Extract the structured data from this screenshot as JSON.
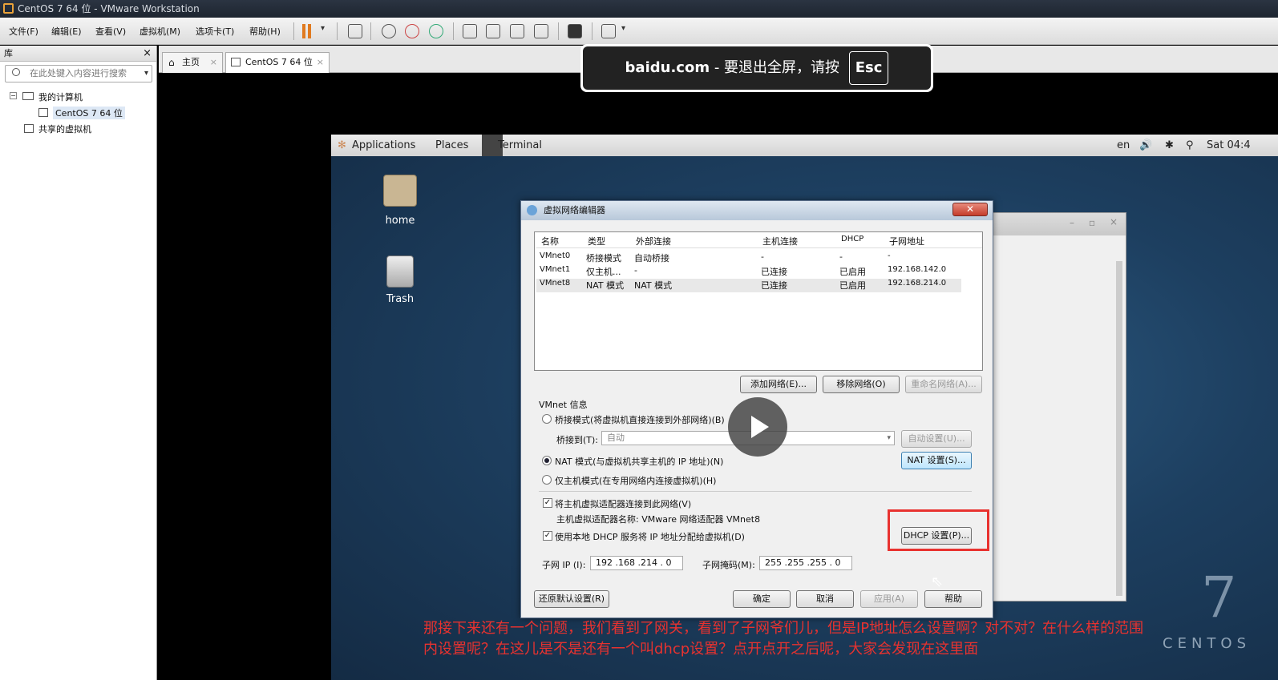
{
  "window_title": "CentOS 7 64 位 - VMware Workstation",
  "menu": [
    "文件(F)",
    "编辑(E)",
    "查看(V)",
    "虚拟机(M)",
    "选项卡(T)",
    "帮助(H)"
  ],
  "library": {
    "title": "库",
    "close": "×",
    "search_placeholder": "在此处键入内容进行搜索",
    "tree": {
      "my_computer": "我的计算机",
      "vm": "CentOS 7 64 位",
      "shared": "共享的虚拟机"
    }
  },
  "tabs": [
    {
      "label": "主页"
    },
    {
      "label": "CentOS 7 64 位"
    }
  ],
  "toast": {
    "site": "baidu.com",
    "message": "- 要退出全屏，请按",
    "key": "Esc"
  },
  "gnome": {
    "applications": "Applications",
    "places": "Places",
    "terminal": "Terminal",
    "lang": "en",
    "clock": "Sat 04:4"
  },
  "desktop": {
    "home": "home",
    "trash": "Trash"
  },
  "dialog": {
    "title": "虚拟网络编辑器",
    "close": "✕",
    "columns": [
      "名称",
      "类型",
      "外部连接",
      "主机连接",
      "DHCP",
      "子网地址"
    ],
    "rows": [
      [
        "VMnet0",
        "桥接模式",
        "自动桥接",
        "-",
        "-",
        "-"
      ],
      [
        "VMnet1",
        "仅主机...",
        "-",
        "已连接",
        "已启用",
        "192.168.142.0"
      ],
      [
        "VMnet8",
        "NAT 模式",
        "NAT 模式",
        "已连接",
        "已启用",
        "192.168.214.0"
      ]
    ],
    "add_network": "添加网络(E)...",
    "remove_network": "移除网络(O)",
    "rename_network": "重命名网络(A)...",
    "vmnet_info": "VMnet 信息",
    "bridge_mode": "桥接模式(将虚拟机直接连接到外部网络)(B)",
    "bridge_to_label": "桥接到(T):",
    "bridge_to_value": "自动",
    "auto_settings": "自动设置(U)...",
    "nat_mode": "NAT 模式(与虚拟机共享主机的 IP 地址)(N)",
    "nat_settings": "NAT 设置(S)...",
    "host_only": "仅主机模式(在专用网络内连接虚拟机)(H)",
    "connect_adapter": "将主机虚拟适配器连接到此网络(V)",
    "adapter_name": "主机虚拟适配器名称: VMware 网络适配器 VMnet8",
    "use_dhcp": "使用本地 DHCP 服务将 IP 地址分配给虚拟机(D)",
    "dhcp_settings": "DHCP 设置(P)...",
    "subnet_ip_label": "子网 IP (I):",
    "subnet_ip": "192 .168 .214 . 0",
    "subnet_mask_label": "子网掩码(M):",
    "subnet_mask": "255 .255 .255 . 0",
    "restore_defaults": "还原默认设置(R)",
    "ok": "确定",
    "cancel": "取消",
    "apply": "应用(A)",
    "help": "帮助"
  },
  "subtitle_line1": "那接下来还有一个问题，我们看到了网关，看到了子网爷们儿，但是IP地址怎么设置啊？对不对？在什么样的范围",
  "subtitle_line2": "内设置呢？在这儿是不是还有一个叫dhcp设置？点开点开之后呢，大家会发现在这里面",
  "centos_brand": "CENTOS",
  "centos_seven": "7",
  "colors": {
    "highlight": "#e8322f",
    "subtitle": "#e8322f"
  }
}
